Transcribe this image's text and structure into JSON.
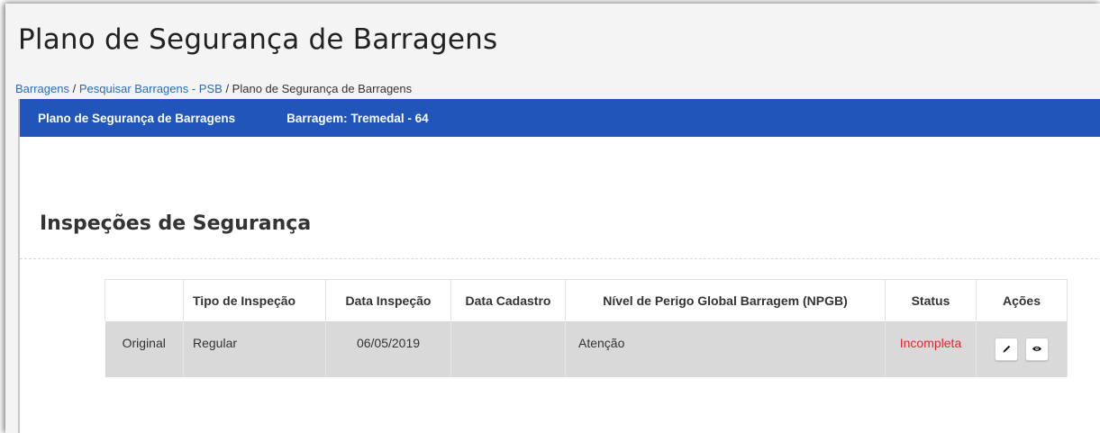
{
  "page": {
    "title": "Plano de Segurança de Barragens"
  },
  "breadcrumb": [
    {
      "label": "Barragens",
      "link": true
    },
    {
      "label": "Pesquisar Barragens - PSB",
      "link": true
    },
    {
      "label": "Plano de Segurança de Barragens",
      "link": false
    }
  ],
  "panel": {
    "header_title": "Plano de Segurança de Barragens",
    "header_barragem": "Barragem: Tremedal - 64",
    "section_title": "Inspeções de Segurança"
  },
  "table": {
    "headers": [
      "",
      "Tipo de Inspeção",
      "Data Inspeção",
      "Data Cadastro",
      "Nível de Perigo Global Barragem (NPGB)",
      "Status",
      "Ações"
    ],
    "rows": [
      {
        "origem": "Original",
        "tipo": "Regular",
        "data_inspecao": "06/05/2019",
        "data_cadastro": "",
        "npgb": "Atenção",
        "status": "Incompleta",
        "actions": [
          "pencil-icon",
          "eye-icon"
        ]
      }
    ]
  },
  "colors": {
    "header_blue": "#2155b9",
    "link_blue": "#2a6db6",
    "status_red": "#e8222f",
    "row_gray": "#d9d9d9"
  }
}
